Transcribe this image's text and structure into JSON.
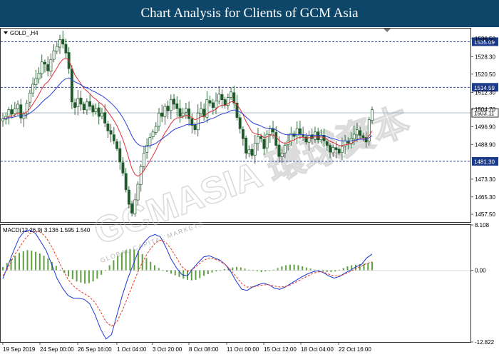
{
  "header": {
    "title": "Chart Analysis for Clients of GCM Asia"
  },
  "colors": {
    "header_bg": "#0d4668",
    "candle": "#1e5a2a",
    "ma_fast": "#e0303a",
    "ma_slow": "#2a3fd8",
    "level_line": "#1b2f8f",
    "macd_hist": "#5fa042",
    "macd_line": "#1d36d6",
    "macd_signal": "#e03a2a",
    "label_bg": "#1b3a8a"
  },
  "chart_data": [
    {
      "type": "candlestick",
      "symbol_label": "GOLD_,H4",
      "title": "",
      "ylim": [
        1454,
        1541
      ],
      "y_ticks": [
        1536.5,
        1528.3,
        1520.5,
        1512.3,
        1504.7,
        1496.9,
        1488.9,
        1473.3,
        1465.3,
        1457.5
      ],
      "x_ticks": [
        "19 Sep 2019",
        "24 Sep 00:00",
        "26 Sep 16:00",
        "1 Oct 04:00",
        "3 Oct 20:00",
        "8 Oct 08:00",
        "11 Oct 00:00",
        "15 Oct 12:00",
        "18 Oct 04:00",
        "22 Oct 16:00"
      ],
      "horizontal_levels": [
        1535.09,
        1514.59,
        1481.3
      ],
      "current_price": 1503.11,
      "closes": [
        1500.5,
        1501.5,
        1504.5,
        1502.5,
        1505,
        1507,
        1500.8,
        1502.5,
        1507.5,
        1512,
        1516,
        1518.5,
        1521,
        1526,
        1525,
        1522,
        1527,
        1531,
        1533,
        1536,
        1534,
        1530,
        1523,
        1508,
        1505.5,
        1509.5,
        1507,
        1504.5,
        1508,
        1506,
        1503.5,
        1505,
        1501.5,
        1503,
        1498.5,
        1495,
        1493.5,
        1490.5,
        1487,
        1481,
        1476,
        1468.5,
        1462,
        1458,
        1464,
        1471,
        1479,
        1485,
        1488.5,
        1492,
        1494.5,
        1497,
        1503,
        1501.5,
        1506,
        1504,
        1509,
        1507,
        1505,
        1501.5,
        1503,
        1505,
        1500.5,
        1497.5,
        1495.5,
        1503,
        1505,
        1501.5,
        1509,
        1507.5,
        1505.5,
        1508.5,
        1511.5,
        1509,
        1506.5,
        1510,
        1512.5,
        1507.5,
        1501,
        1496,
        1491.5,
        1485,
        1486.5,
        1484,
        1489.5,
        1492.5,
        1491.5,
        1487,
        1493.5,
        1496,
        1494.5,
        1488.5,
        1483.5,
        1485,
        1488.5,
        1490.5,
        1494,
        1492.5,
        1496,
        1493.5,
        1492.5,
        1490,
        1493,
        1491.5,
        1494.5,
        1491,
        1493,
        1490.5,
        1488.5,
        1485.5,
        1487.5,
        1486.5,
        1485,
        1488,
        1490.5,
        1489.5,
        1491.5,
        1493.5,
        1495.5,
        1493,
        1492,
        1490,
        1500,
        1504.5
      ]
    },
    {
      "type": "bar+line",
      "indicator": "MACD(12,26,9)",
      "indicator_values": [
        "3.136",
        "1.595",
        "1.540"
      ],
      "ylim": [
        -12.822,
        8.108
      ],
      "y_ticks": [
        8.108,
        0.0,
        -12.822
      ],
      "series": [
        {
          "name": "",
          "kind": "histogram",
          "values": [
            0.6,
            1.3,
            2.0,
            2.6,
            3.1,
            3.4,
            3.6,
            3.5,
            3.3,
            3.0,
            2.6,
            2.1,
            1.5,
            0.8,
            0.1,
            -0.5,
            -1.1,
            -1.6,
            -2.0,
            -2.2,
            -2.4,
            -2.3,
            -2.0,
            -1.5,
            -0.8,
            0.0,
            0.9,
            1.8,
            2.6,
            3.2,
            3.6,
            3.8,
            3.7,
            3.4,
            2.9,
            2.2,
            1.5,
            0.9,
            0.4,
            0.0,
            -0.3,
            -0.6,
            -0.9,
            -1.2,
            -1.5,
            -1.7,
            -1.8,
            -1.7,
            -1.4,
            -1.0,
            -0.7,
            -0.4,
            -0.2,
            0.0,
            0.2,
            0.4,
            0.5,
            0.6,
            0.5,
            0.3,
            0.1,
            -0.1,
            -0.2,
            -0.3,
            -0.2,
            -0.1,
            0.1,
            0.4,
            0.7,
            0.9,
            1.0,
            1.0,
            0.9,
            0.7,
            0.5,
            0.3,
            0.1,
            -0.1,
            -0.2,
            -0.3,
            -0.3,
            -0.2,
            0.1,
            0.4,
            0.7,
            0.9,
            1.0,
            1.1,
            1.2,
            1.3,
            1.5
          ]
        },
        {
          "name": "",
          "kind": "line",
          "values": [
            -1.5,
            1.0,
            3.5,
            5.8,
            7.0,
            7.2,
            6.6,
            5.1,
            3.5,
            1.0,
            -1.5,
            -3.2,
            -4.5,
            -5.0,
            -5.0,
            -5.2,
            -6.0,
            -8.0,
            -10.5,
            -12.3,
            -11.5,
            -8.0,
            -4.5,
            -1.5,
            1.0,
            3.5,
            5.0,
            6.0,
            6.4,
            6.0,
            4.2,
            2.0,
            0.4,
            -0.8,
            -1.0,
            0.3,
            1.4,
            2.4,
            2.6,
            2.2,
            1.8,
            1.0,
            -0.3,
            -2.0,
            -3.4,
            -3.6,
            -3.0,
            -2.6,
            -2.3,
            -2.6,
            -3.2,
            -3.4,
            -3.0,
            -2.4,
            -1.8,
            -1.2,
            -0.7,
            -0.3,
            -0.1,
            -0.4,
            -1.0,
            -1.4,
            -1.1,
            -0.5,
            0.0,
            0.6,
            1.0,
            2.2,
            2.9
          ]
        },
        {
          "name": "",
          "kind": "signal",
          "values": [
            -1.0,
            0.5,
            2.5,
            4.0,
            5.5,
            6.6,
            7.0,
            6.8,
            5.8,
            4.2,
            2.2,
            0.2,
            -1.6,
            -2.8,
            -3.6,
            -4.2,
            -4.8,
            -5.8,
            -7.4,
            -9.2,
            -10.0,
            -9.2,
            -7.2,
            -4.8,
            -2.4,
            0.0,
            2.0,
            3.6,
            4.8,
            5.4,
            5.0,
            3.8,
            2.2,
            0.6,
            -0.2,
            0.2,
            1.0,
            1.8,
            2.2,
            2.0,
            1.6,
            1.0,
            0.0,
            -1.2,
            -2.4,
            -3.0,
            -3.0,
            -2.8,
            -2.6,
            -2.6,
            -2.8,
            -3.0,
            -2.9,
            -2.6,
            -2.1,
            -1.6,
            -1.1,
            -0.6,
            -0.3,
            -0.3,
            -0.7,
            -1.0,
            -1.0,
            -0.7,
            -0.2,
            0.3,
            0.7,
            1.2,
            1.5
          ]
        }
      ]
    }
  ],
  "watermark": {
    "main": "GCMASIA 環球資本",
    "sub": "GLOBAL CAPITAL MARKETS"
  }
}
